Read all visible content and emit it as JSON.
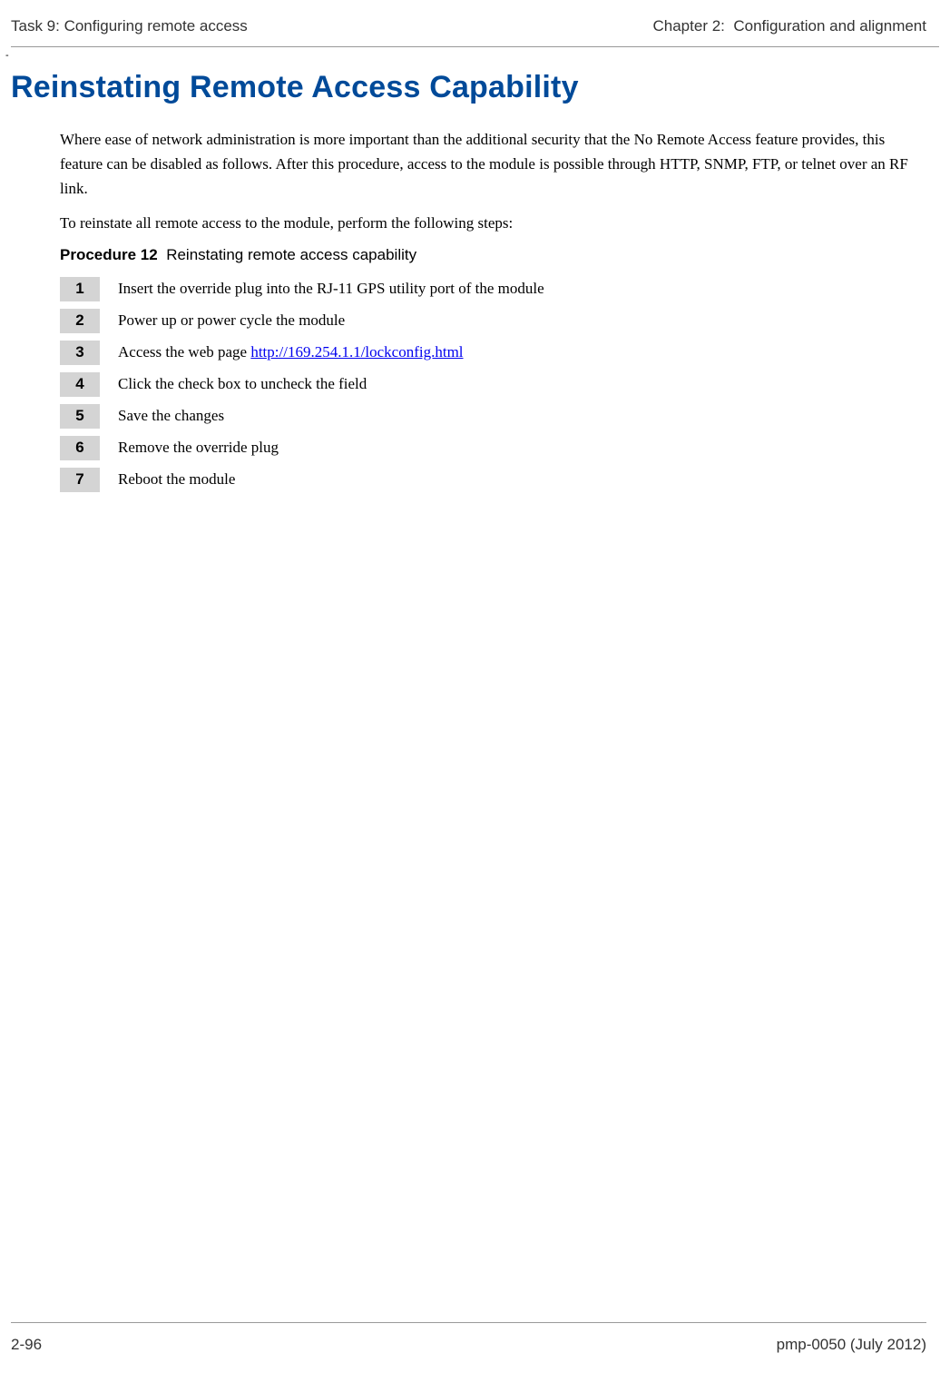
{
  "header": {
    "left": "Task 9: Configuring remote access",
    "right_prefix": "Chapter 2:",
    "right_suffix": "Configuration and alignment"
  },
  "dash": "-",
  "title": "Reinstating Remote Access Capability",
  "intro1": "Where ease of network administration is more important than the additional security that the No Remote Access feature provides, this feature can be disabled as follows.  After this procedure, access to the module is possible through HTTP, SNMP, FTP, or telnet over an RF link.",
  "intro2": "To reinstate all remote access to the module, perform the following steps:",
  "procedure": {
    "label": "Procedure 12",
    "title": "Reinstating remote access capability"
  },
  "steps": [
    {
      "num": "1",
      "text": "Insert the override plug into the RJ-11 GPS utility port of the module"
    },
    {
      "num": "2",
      "text": "Power up or power cycle the module"
    },
    {
      "num": "3",
      "prefix": "Access the web page ",
      "link": "http://169.254.1.1/lockconfig.html"
    },
    {
      "num": "4",
      "text": "Click the check box to uncheck the field"
    },
    {
      "num": "5",
      "text": "Save the changes"
    },
    {
      "num": "6",
      "text": "Remove the override plug"
    },
    {
      "num": "7",
      "text": "Reboot the module"
    }
  ],
  "footer": {
    "left": "2-96",
    "right": "pmp-0050 (July 2012)"
  }
}
